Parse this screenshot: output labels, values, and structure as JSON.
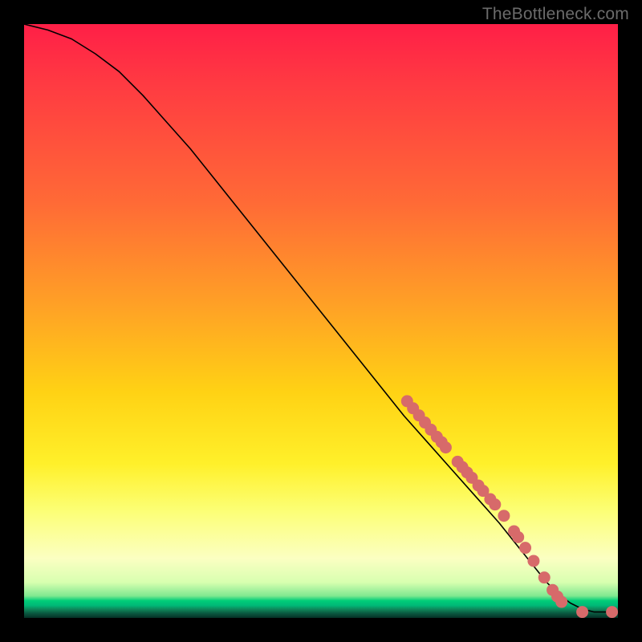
{
  "watermark": "TheBottleneck.com",
  "chart_data": {
    "type": "line",
    "title": "",
    "xlabel": "",
    "ylabel": "",
    "xlim": [
      0,
      100
    ],
    "ylim": [
      0,
      100
    ],
    "grid": false,
    "legend": false,
    "series": [
      {
        "name": "curve",
        "x": [
          0,
          4,
          8,
          12,
          16,
          20,
          24,
          28,
          32,
          36,
          40,
          44,
          48,
          52,
          56,
          60,
          64,
          68,
          72,
          76,
          80,
          82,
          84,
          86,
          88,
          90,
          92,
          94,
          96,
          98,
          100
        ],
        "y": [
          100,
          99,
          97.5,
          95,
          92,
          88,
          83.5,
          79,
          74,
          69,
          64,
          59,
          54,
          49,
          44,
          39,
          34,
          29.5,
          25,
          20.5,
          16,
          13.5,
          11,
          8.5,
          6,
          4,
          2.5,
          1.5,
          1,
          1,
          1
        ],
        "color": "#000000",
        "linewidth": 1.6
      }
    ],
    "markers": {
      "name": "dots",
      "color": "#d76a6a",
      "radius": 7.5,
      "points": [
        {
          "x": 64.5,
          "y": 36.5
        },
        {
          "x": 65.5,
          "y": 35.3
        },
        {
          "x": 66.5,
          "y": 34.1
        },
        {
          "x": 67.5,
          "y": 32.9
        },
        {
          "x": 68.5,
          "y": 31.7
        },
        {
          "x": 69.5,
          "y": 30.5
        },
        {
          "x": 70.3,
          "y": 29.6
        },
        {
          "x": 71.0,
          "y": 28.7
        },
        {
          "x": 73.0,
          "y": 26.3
        },
        {
          "x": 73.8,
          "y": 25.4
        },
        {
          "x": 74.6,
          "y": 24.5
        },
        {
          "x": 75.4,
          "y": 23.6
        },
        {
          "x": 76.5,
          "y": 22.3
        },
        {
          "x": 77.3,
          "y": 21.4
        },
        {
          "x": 78.5,
          "y": 20.0
        },
        {
          "x": 79.3,
          "y": 19.1
        },
        {
          "x": 80.8,
          "y": 17.2
        },
        {
          "x": 82.5,
          "y": 14.6
        },
        {
          "x": 83.2,
          "y": 13.6
        },
        {
          "x": 84.4,
          "y": 11.8
        },
        {
          "x": 85.8,
          "y": 9.6
        },
        {
          "x": 87.6,
          "y": 6.8
        },
        {
          "x": 89.0,
          "y": 4.7
        },
        {
          "x": 89.8,
          "y": 3.6
        },
        {
          "x": 90.5,
          "y": 2.7
        },
        {
          "x": 94.0,
          "y": 1.0
        },
        {
          "x": 99.0,
          "y": 1.0
        }
      ]
    }
  }
}
